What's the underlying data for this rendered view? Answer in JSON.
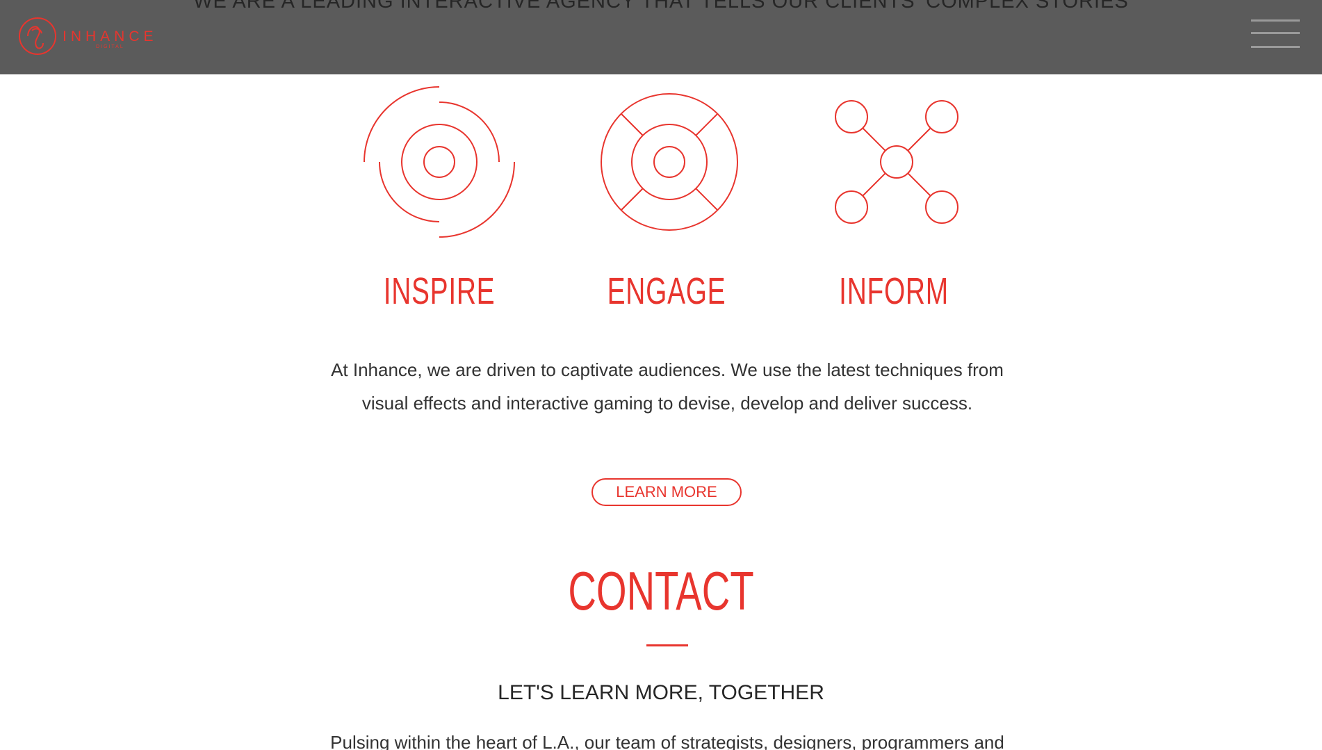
{
  "header": {
    "tagline": "WE ARE A LEADING INTERACTIVE AGENCY THAT TELLS OUR CLIENTS' COMPLEX STORIES",
    "logo_text": "INHANCE",
    "logo_subtext": "DIGITAL",
    "menu_icon": "hamburger-menu-icon"
  },
  "pillars": [
    {
      "label": "INSPIRE",
      "icon": "concentric-circles-icon"
    },
    {
      "label": "ENGAGE",
      "icon": "target-ring-icon"
    },
    {
      "label": "INFORM",
      "icon": "network-nodes-icon"
    }
  ],
  "intro": {
    "line1": "At Inhance, we are driven to captivate audiences. We use the latest techniques from",
    "line2": "visual effects and interactive gaming to devise, develop and deliver success."
  },
  "learn_more": {
    "label": "LEARN MORE"
  },
  "contact": {
    "title": "CONTACT",
    "subtitle": "LET'S LEARN MORE, TOGETHER",
    "body": "Pulsing within the heart of L.A., our team of strategists, designers, programmers and"
  },
  "colors": {
    "accent": "#e8352e",
    "header_bg": "#5b5b5b",
    "text": "#333333"
  }
}
